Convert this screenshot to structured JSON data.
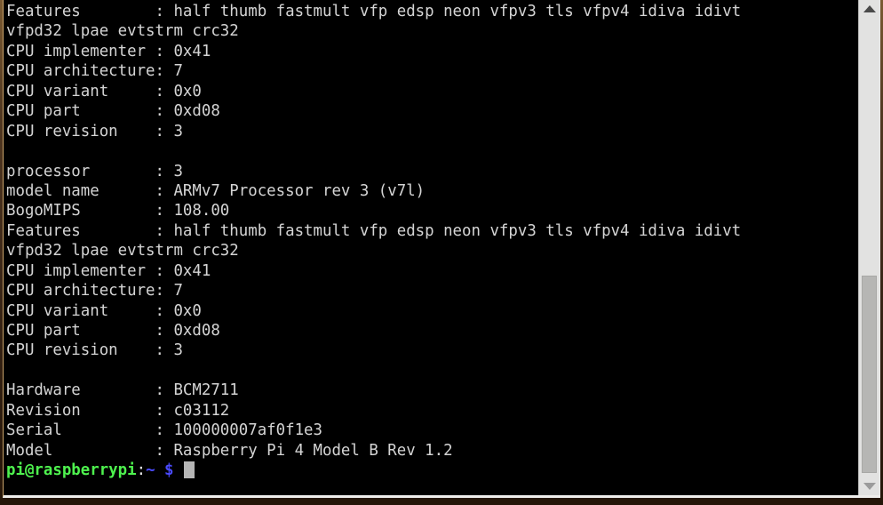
{
  "window": {
    "app": "LXTerminal",
    "background_color": "#000000",
    "foreground_color": "#d4d4d4"
  },
  "terminal": {
    "command_output_description": "cat /proc/cpuinfo output tail",
    "lines": [
      "Features        : half thumb fastmult vfp edsp neon vfpv3 tls vfpv4 idiva idivt",
      "vfpd32 lpae evtstrm crc32",
      "CPU implementer : 0x41",
      "CPU architecture: 7",
      "CPU variant     : 0x0",
      "CPU part        : 0xd08",
      "CPU revision    : 3",
      "",
      "processor       : 3",
      "model name      : ARMv7 Processor rev 3 (v7l)",
      "BogoMIPS        : 108.00",
      "Features        : half thumb fastmult vfp edsp neon vfpv3 tls vfpv4 idiva idivt",
      "vfpd32 lpae evtstrm crc32",
      "CPU implementer : 0x41",
      "CPU architecture: 7",
      "CPU variant     : 0x0",
      "CPU part        : 0xd08",
      "CPU revision    : 3",
      "",
      "Hardware        : BCM2711",
      "Revision        : c03112",
      "Serial          : 100000007af0f1e3",
      "Model           : Raspberry Pi 4 Model B Rev 1.2"
    ],
    "fields": {
      "cpu_implementer": "0x41",
      "cpu_architecture": "7",
      "cpu_variant": "0x0",
      "cpu_part": "0xd08",
      "cpu_revision": "3",
      "processor": "3",
      "model_name": "ARMv7 Processor rev 3 (v7l)",
      "bogomips": "108.00",
      "features": "half thumb fastmult vfp edsp neon vfpv3 tls vfpv4 idiva idivt vfpd32 lpae evtstrm crc32",
      "hardware": "BCM2711",
      "revision": "c03112",
      "serial": "100000007af0f1e3",
      "model": "Raspberry Pi 4 Model B Rev 1.2"
    }
  },
  "prompt": {
    "user_host": "pi@raspberrypi",
    "colon": ":",
    "path": "~",
    "symbol": "$",
    "input_value": "",
    "user_host_color": "#4ef24e",
    "path_color": "#4a4aff",
    "cursor_color": "#b5b5b5"
  },
  "scrollbar": {
    "up_arrow": "▲",
    "down_arrow": "▼",
    "thumb_position_percent": 57,
    "thumb_size_percent": 41
  }
}
